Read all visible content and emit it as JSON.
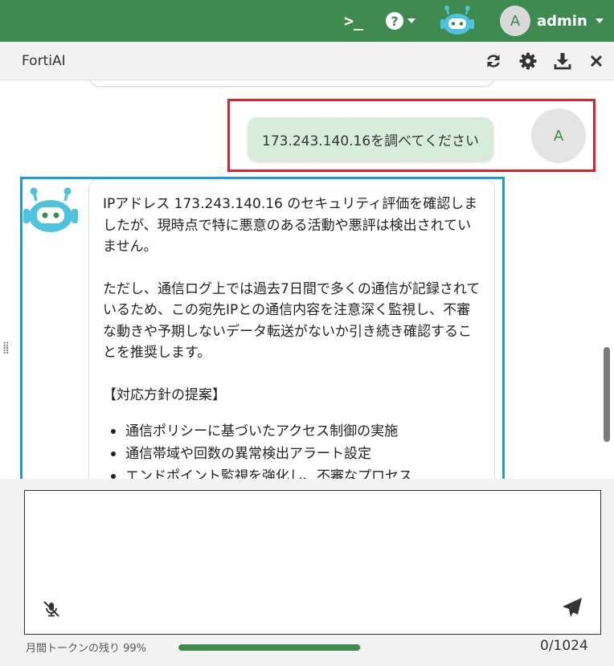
{
  "topbar": {
    "cli_icon": "terminal-icon",
    "cli_label": ">_",
    "help_label": "?",
    "user_initial": "A",
    "user_name": "admin"
  },
  "panel": {
    "title": "FortiAI",
    "icons": [
      "refresh-icon",
      "gear-icon",
      "download-icon",
      "close-icon"
    ]
  },
  "chat": {
    "user_message": "173.243.140.16を調べてください",
    "user_avatar": "A",
    "bot_paragraph_1": "IPアドレス 173.243.140.16 のセキュリティ評価を確認しましたが、現時点で特に悪意のある活動や悪評は検出されていません。",
    "bot_paragraph_2": "ただし、通信ログ上では過去7日間で多くの通信が記録されているため、この宛先IPとの通信内容を注意深く監視し、不審な動きや予期しないデータ転送がないか引き続き確認することを推奨します。",
    "bot_heading": "【対応方針の提案】",
    "bot_bullets": [
      "通信ポリシーに基づいたアクセス制御の実施",
      "通信帯域や回数の異常検出アラート設定",
      "エンドポイント監視を強化し、不審なプロセス"
    ]
  },
  "input": {
    "value": "",
    "placeholder": "",
    "token_label": "月間トークンの残り 99%",
    "token_percent": 99,
    "char_count": "0/1024"
  },
  "colors": {
    "topbar": "#3f8a4f",
    "user_bubble": "#d7ecd9",
    "highlight_red": "#e0202a",
    "highlight_blue": "#1e9ad6",
    "bot_accent": "#4ec3e0"
  }
}
